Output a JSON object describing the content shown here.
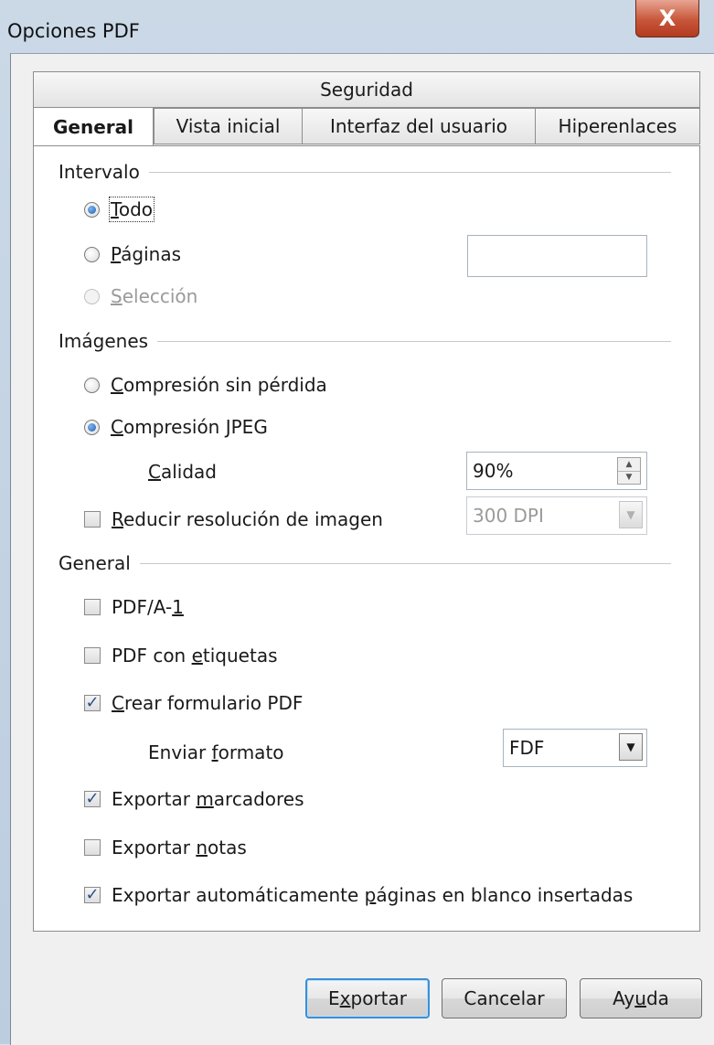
{
  "window": {
    "title": "Opciones PDF",
    "close_label": "X"
  },
  "tabs": {
    "row_top": [
      "Seguridad"
    ],
    "row_bottom": [
      "General",
      "Vista inicial",
      "Interfaz del usuario",
      "Hiperenlaces"
    ],
    "active": "General"
  },
  "intervalo": {
    "heading": "Intervalo",
    "todo": {
      "before": "",
      "key": "T",
      "after": "odo",
      "selected": true
    },
    "paginas": {
      "before": "",
      "key": "P",
      "after": "áginas",
      "selected": false,
      "value": ""
    },
    "seleccion": {
      "before": "",
      "key": "S",
      "after": "elección",
      "selected": false,
      "disabled": true
    }
  },
  "imagenes": {
    "heading": "Imágenes",
    "sin_perdida": {
      "before": "",
      "key": "C",
      "after": "ompresión sin pérdida",
      "selected": false
    },
    "jpeg": {
      "before": "",
      "key": "C",
      "after": "ompresión JPEG",
      "selected": true
    },
    "calidad": {
      "before": "",
      "key": "C",
      "after": "alidad",
      "value": "90%"
    },
    "reducir": {
      "before": "",
      "key": "R",
      "after": "educir resolución de imagen",
      "checked": false,
      "value": "300 DPI"
    }
  },
  "general": {
    "heading": "General",
    "pdfa": {
      "before": "PDF/A-",
      "key": "1",
      "after": "",
      "checked": false
    },
    "etiquetas": {
      "before": "PDF con ",
      "key": "e",
      "after": "tiquetas",
      "checked": false
    },
    "formulario": {
      "before": "",
      "key": "C",
      "after": "rear formulario PDF",
      "checked": true
    },
    "enviar": {
      "before": "Enviar ",
      "key": "f",
      "after": "ormato",
      "value": "FDF"
    },
    "marcadores": {
      "before": "Exportar ",
      "key": "m",
      "after": "arcadores",
      "checked": true
    },
    "notas": {
      "before": "Exportar ",
      "key": "n",
      "after": "otas",
      "checked": false
    },
    "blanco": {
      "before": "Exportar automáticamente ",
      "key": "p",
      "after": "áginas en blanco insertadas",
      "checked": true
    }
  },
  "buttons": {
    "exportar": {
      "before": "E",
      "key": "x",
      "after": "portar"
    },
    "cancelar": {
      "label": "Cancelar"
    },
    "ayuda": {
      "before": "Ay",
      "key": "u",
      "after": "da"
    }
  },
  "colors": {
    "accent": "#3b8fd6",
    "close": "#c8563a",
    "radio_dot": "#1e5fb0"
  }
}
